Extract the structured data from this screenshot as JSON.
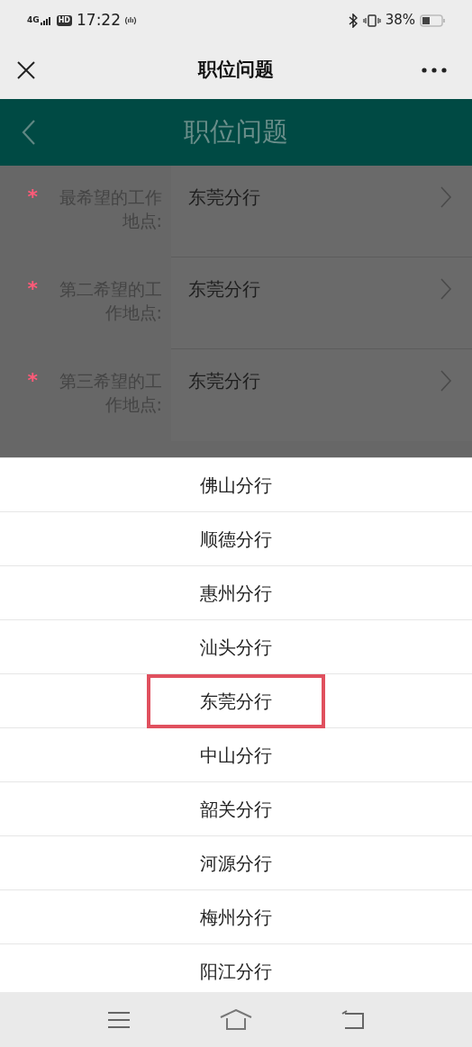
{
  "status_bar": {
    "network": "4G",
    "hd": "HD",
    "time": "17:22",
    "battery": "38%"
  },
  "nav_bar": {
    "title": "职位问题"
  },
  "page_header": {
    "title": "职位问题"
  },
  "form_fields": [
    {
      "required_mark": "*",
      "label": "最希望的工作地点:",
      "required": true,
      "value": "东莞分行"
    },
    {
      "required_mark": "*",
      "label": "第二希望的工作地点:",
      "required": true,
      "value": "东莞分行"
    },
    {
      "required_mark": "*",
      "label": "第三希望的工作地点:",
      "required": true,
      "value": "东莞分行"
    }
  ],
  "picker_options": [
    {
      "label": "佛山分行",
      "highlighted": false
    },
    {
      "label": "顺德分行",
      "highlighted": false
    },
    {
      "label": "惠州分行",
      "highlighted": false
    },
    {
      "label": "汕头分行",
      "highlighted": false
    },
    {
      "label": "东莞分行",
      "highlighted": true
    },
    {
      "label": "中山分行",
      "highlighted": false
    },
    {
      "label": "韶关分行",
      "highlighted": false
    },
    {
      "label": "河源分行",
      "highlighted": false
    },
    {
      "label": "梅州分行",
      "highlighted": false
    },
    {
      "label": "阳江分行",
      "highlighted": false
    }
  ]
}
